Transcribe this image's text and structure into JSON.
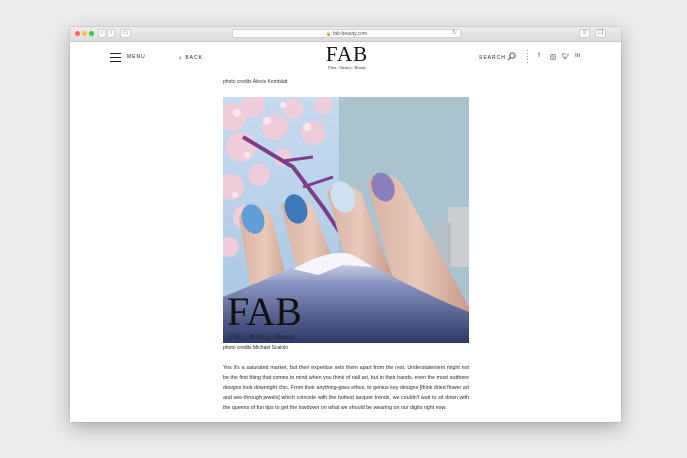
{
  "browser": {
    "url": "fab-beauty.com",
    "nav_back_icon": "chevron-left-icon",
    "nav_forward_icon": "chevron-right-icon"
  },
  "header": {
    "menu_label": "MENU",
    "back_label": "BACK",
    "logo": "FAB",
    "tagline": "Flair / Artistry / Beauty",
    "search_label": "SEARCH",
    "social": [
      "f",
      "instagram",
      "twitter",
      "in"
    ]
  },
  "article": {
    "top_credit": "photo credits Alexis Kornblatt",
    "image_logo": "FAB",
    "image_tagline": "Flair / Artistry / Beauty",
    "image_credit": "photo credits Michael Scalolo",
    "paragraph": "Yes it's a saturated market, but their expertise sets them apart from the rest. Understatement might not be the first thing that comes to mind when you think of nail art, but in their hands, even the most outthere designs look downright chic. From their anything-goes ethos, to genius key designs [think dried flower art and see-through jewels] which coincide with the hottest lacquer trends, we couldn't wait to sit down with the queens of fun tips to get the lowdown on what we should be wearing on our digits right now."
  },
  "colors": {
    "page_bg": "#ececec",
    "sky_left": "#b9d2e8",
    "sky_right": "#a9c6d6",
    "mountain": "#3d4a78",
    "blossom": "#f2c9d8"
  }
}
